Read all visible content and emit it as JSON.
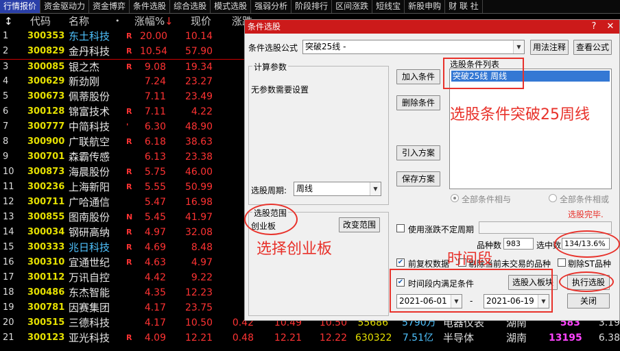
{
  "tabs": [
    "行情报价",
    "资金驱动力",
    "资金博弈",
    "条件选股",
    "综合选股",
    "模式选股",
    "强弱分析",
    "阶段排行",
    "区间涨跌",
    "短线宝",
    "新股申购",
    "财 联 社"
  ],
  "table": {
    "headers": {
      "code": "代码",
      "name": "名称",
      "dot": "•",
      "pct": "涨幅%",
      "sort": "↓",
      "price": "现价",
      "col7": "涨跌"
    },
    "rows": [
      {
        "idx": "1",
        "code": "300353",
        "name": "东土科技",
        "flag": "R",
        "pct": "20.00",
        "price": "10.14",
        "blue": true
      },
      {
        "idx": "2",
        "code": "300829",
        "name": "金丹科技",
        "flag": "R",
        "pct": "10.54",
        "price": "57.90"
      },
      {
        "idx": "3",
        "code": "300085",
        "name": "银之杰",
        "flag": "R",
        "pct": "9.08",
        "price": "19.34"
      },
      {
        "idx": "4",
        "code": "300629",
        "name": "新劲刚",
        "flag": "",
        "pct": "7.24",
        "price": "23.27"
      },
      {
        "idx": "5",
        "code": "300673",
        "name": "佩蒂股份",
        "flag": "",
        "pct": "7.11",
        "price": "23.49"
      },
      {
        "idx": "6",
        "code": "300128",
        "name": "锦富技术",
        "flag": "R",
        "pct": "7.11",
        "price": "4.22"
      },
      {
        "idx": "7",
        "code": "300777",
        "name": "中简科技",
        "flag": "'",
        "pct": "6.30",
        "price": "48.90"
      },
      {
        "idx": "8",
        "code": "300900",
        "name": "广联航空",
        "flag": "R",
        "pct": "6.18",
        "price": "38.63"
      },
      {
        "idx": "9",
        "code": "300701",
        "name": "森霸传感",
        "flag": "",
        "pct": "6.13",
        "price": "23.38"
      },
      {
        "idx": "10",
        "code": "300873",
        "name": "海晨股份",
        "flag": "R",
        "pct": "5.75",
        "price": "46.00"
      },
      {
        "idx": "11",
        "code": "300236",
        "name": "上海新阳",
        "flag": "R",
        "pct": "5.55",
        "price": "50.99"
      },
      {
        "idx": "12",
        "code": "300711",
        "name": "广哈通信",
        "flag": "",
        "pct": "5.47",
        "price": "16.98"
      },
      {
        "idx": "13",
        "code": "300855",
        "name": "图南股份",
        "flag": "N",
        "pct": "5.45",
        "price": "41.97"
      },
      {
        "idx": "14",
        "code": "300034",
        "name": "钢研高纳",
        "flag": "R",
        "pct": "4.97",
        "price": "32.08"
      },
      {
        "idx": "15",
        "code": "300333",
        "name": "兆日科技",
        "flag": "R",
        "pct": "4.69",
        "price": "8.48",
        "blue": true
      },
      {
        "idx": "16",
        "code": "300310",
        "name": "宜通世纪",
        "flag": "R",
        "pct": "4.63",
        "price": "4.97"
      },
      {
        "idx": "17",
        "code": "300112",
        "name": "万讯自控",
        "flag": "",
        "pct": "4.42",
        "price": "9.22"
      },
      {
        "idx": "18",
        "code": "300486",
        "name": "东杰智能",
        "flag": "",
        "pct": "4.35",
        "price": "12.23"
      },
      {
        "idx": "19",
        "code": "300781",
        "name": "因赛集团",
        "flag": "",
        "pct": "4.17",
        "price": "23.75"
      },
      {
        "idx": "20",
        "code": "300515",
        "name": "三德科技",
        "flag": "",
        "pct": "4.17",
        "price": "10.50",
        "x1": "0.42",
        "x2": "10.49",
        "x3": "10.50",
        "vol": "55686",
        "amt": "5790万",
        "ind": "电器仪表",
        "reg": "湖南",
        "n": "583",
        "r": "3.19"
      },
      {
        "idx": "21",
        "code": "300123",
        "name": "亚光科技",
        "flag": "R",
        "pct": "4.09",
        "price": "12.21",
        "x1": "0.48",
        "x2": "12.21",
        "x3": "12.22",
        "vol": "630322",
        "amt": "7.51亿",
        "ind": "半导体",
        "reg": "湖南",
        "n": "13195",
        "r": "6.38"
      }
    ]
  },
  "dialog": {
    "title": "条件选股",
    "formula_label": "条件选股公式",
    "formula_value": "突破25线         -",
    "btn_usage": "用法注释",
    "btn_view": "查看公式",
    "params_title": "计算参数",
    "params_text": "无参数需要设置",
    "btn_add": "加入条件",
    "btn_delete": "删除条件",
    "btn_import": "引入方案",
    "btn_save": "保存方案",
    "list_title": "选股条件列表",
    "list_item": "突破25线  周线",
    "period_label": "选股周期:",
    "period_value": "周线",
    "radio_and": "全部条件相与",
    "radio_or": "全部条件相或",
    "status": "选股完毕.",
    "range_title": "选股范围",
    "range_value": "创业板",
    "btn_change_range": "改变范围",
    "chk_uncertain": "使用涨跌不定周期",
    "count_label": "品种数",
    "count_value": "983",
    "selected_label": "选中数",
    "selected_value": "134/13.6%",
    "chk_adjust": "前复权数据",
    "chk_exclude_untraded": "剔除当前未交易的品种",
    "chk_exclude_st": "剔除ST品种",
    "chk_timerange": "时间段内满足条件",
    "btn_to_block": "选股入板块",
    "btn_run": "执行选股",
    "date_from": "2021-06-01",
    "date_dash": "-",
    "date_to": "2021-06-19",
    "btn_close": "关闭"
  },
  "annotations": {
    "cond_text": "选股条件突破25周线",
    "board_text": "选择创业板",
    "time_text": "时间段"
  }
}
